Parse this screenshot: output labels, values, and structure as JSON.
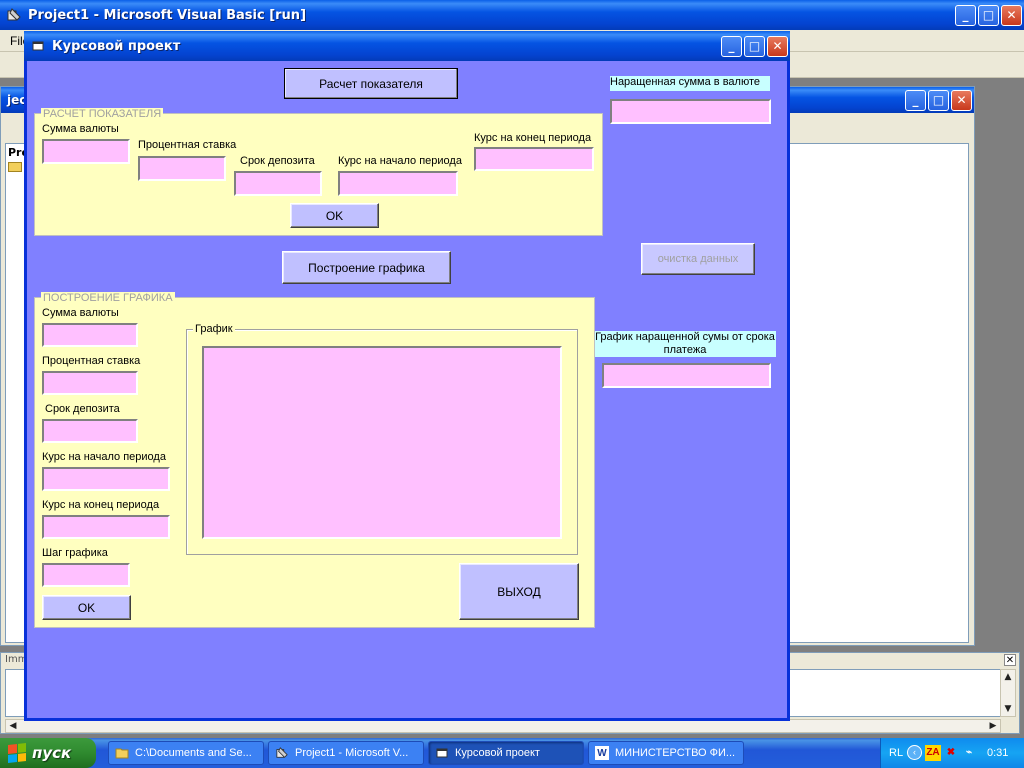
{
  "vb": {
    "title": "Project1 - Microsoft Visual Basic [run]",
    "menu_first": "File",
    "project_window_left_label": "jec",
    "project_tree_label": "Pro",
    "immediate_label": "Imm"
  },
  "form": {
    "title": "Курсовой проект",
    "calc_button": "Расчет показателя",
    "graph_button": "Построение графика",
    "clear_button": "очистка данных",
    "exit_button": "ВЫХОД",
    "accrued_label": "Наращенная сумма в валюте",
    "graph_label": "График наращенной сумы от срока платежа",
    "calc_frame": {
      "caption": "РАСЧЕТ ПОКАЗАТЕЛЯ",
      "amount_label": "Сумма валюты",
      "rate_label": "Процентная ставка",
      "term_label": "Срок депозита",
      "start_rate_label": "Курс на начало периода",
      "end_rate_label": "Курс на конец периода",
      "ok_label": "OK"
    },
    "graph_frame": {
      "caption": "ПОСТРОЕНИЕ ГРАФИКА",
      "amount_label": "Сумма валюты",
      "rate_label": "Процентная ставка",
      "term_label": "Срок депозита",
      "start_rate_label": "Курс на начало периода",
      "end_rate_label": "Курс на конец периода",
      "step_label": "Шаг графика",
      "ok_label": "OK",
      "plot_caption": "График"
    }
  },
  "taskbar": {
    "start_label": "пуск",
    "tasks": [
      {
        "label": "C:\\Documents and Se..."
      },
      {
        "label": "Project1 - Microsoft V..."
      },
      {
        "label": "Курсовой проект"
      },
      {
        "label": "МИНИСТЕРСТВО ФИ..."
      }
    ],
    "lang": "RL",
    "clock": "0:31"
  },
  "colors": {
    "form_bg": "#8080ff",
    "frame_bg": "#ffffc0",
    "field_bg": "#ffc0ff",
    "button_bg": "#c0c0ff",
    "label_cyan_bg": "#c8ffff"
  }
}
